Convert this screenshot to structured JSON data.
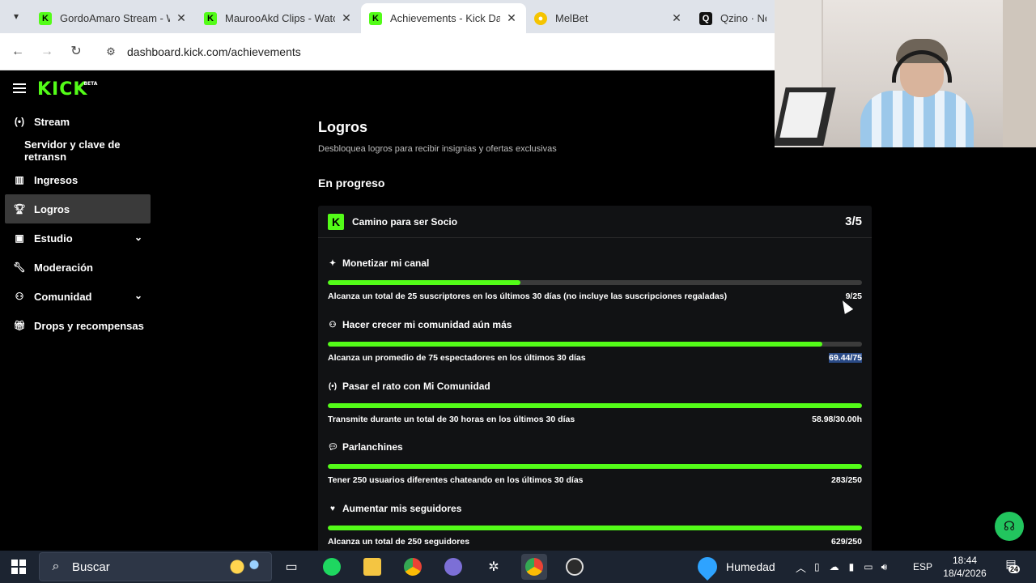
{
  "browser": {
    "tabs": [
      {
        "title": "GordoAmaro Stream - W",
        "icon": "kick-icon",
        "active": false
      },
      {
        "title": "MaurooAkd Clips - Watc",
        "icon": "kick-icon",
        "active": false
      },
      {
        "title": "Achievements - Kick Das",
        "icon": "kick-icon",
        "active": true
      },
      {
        "title": "MelBet",
        "icon": "melbet-icon",
        "active": false
      },
      {
        "title": "Qzino · Next-",
        "icon": "qzino-icon",
        "active": false
      }
    ],
    "url": "dashboard.kick.com/achievements"
  },
  "header": {
    "logo": "KICK",
    "logo_badge": "BETA"
  },
  "sidebar": {
    "items": [
      {
        "label": "Stream",
        "icon": "broadcast-icon"
      },
      {
        "label": "Servidor y clave de retransn"
      },
      {
        "label": "Ingresos",
        "icon": "chart-icon"
      },
      {
        "label": "Logros",
        "icon": "trophy-icon",
        "active": true
      },
      {
        "label": "Estudio",
        "icon": "studio-icon",
        "expandable": true
      },
      {
        "label": "Moderación",
        "icon": "wrench-icon"
      },
      {
        "label": "Comunidad",
        "icon": "community-icon",
        "expandable": true
      },
      {
        "label": "Drops y recompensas",
        "icon": "gift-icon"
      }
    ]
  },
  "main": {
    "title": "Logros",
    "subtitle": "Desbloquea logros para recibir insignias y ofertas exclusivas",
    "section": "En progreso",
    "card": {
      "title": "Camino para ser Socio",
      "count": "3/5",
      "achievements": [
        {
          "name": "Monetizar mi canal",
          "icon": "sparkle-icon",
          "description": "Alcanza un total de 25 suscriptores en los últimos 30 días (no incluye las suscripciones regaladas)",
          "value": "9/25",
          "progress": 0.36
        },
        {
          "name": "Hacer crecer mi comunidad aún más",
          "icon": "users-icon",
          "description": "Alcanza un promedio de 75 espectadores en los últimos 30 días",
          "value": "69.44/75",
          "progress": 0.926
        },
        {
          "name": "Pasar el rato con Mi Comunidad",
          "icon": "broadcast-icon",
          "description": "Transmite durante un total de 30 horas en los últimos 30 días",
          "value": "58.98/30.00h",
          "progress": 1.0
        },
        {
          "name": "Parlanchines",
          "icon": "chat-icon",
          "description": "Tener 250 usuarios diferentes chateando en los últimos 30 días",
          "value": "283/250",
          "progress": 1.0
        },
        {
          "name": "Aumentar mis seguidores",
          "icon": "heart-icon",
          "description": "Alcanza un total de 250 seguidores",
          "value": "629/250",
          "progress": 1.0
        }
      ]
    }
  },
  "taskbar": {
    "search_placeholder": "Buscar",
    "weather": "Humedad",
    "language": "ESP",
    "time": "18:44",
    "date": "18/4/2026",
    "notifications": "24"
  },
  "colors": {
    "accent": "#53fc18",
    "background": "#000000",
    "card": "#111214"
  }
}
